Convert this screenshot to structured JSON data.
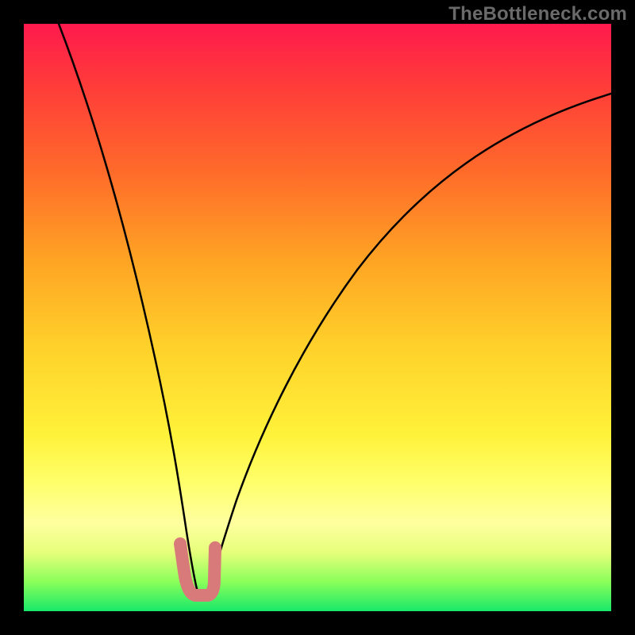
{
  "watermark": "TheBottleneck.com",
  "chart_data": {
    "type": "line",
    "title": "",
    "xlabel": "",
    "ylabel": "",
    "xlim": [
      0,
      100
    ],
    "ylim": [
      0,
      100
    ],
    "grid": false,
    "background_gradient": [
      "#ff1a4d",
      "#ff6a2a",
      "#ffd12a",
      "#ffff6a",
      "#18e86a"
    ],
    "series": [
      {
        "name": "bottleneck-curve",
        "color": "#000000",
        "x": [
          6,
          10,
          14,
          18,
          22,
          24,
          26,
          28,
          29,
          30,
          31,
          32,
          34,
          36,
          40,
          46,
          54,
          64,
          76,
          90,
          100
        ],
        "y": [
          100,
          85,
          68,
          50,
          30,
          18,
          8,
          2,
          0,
          0,
          0,
          2,
          10,
          20,
          36,
          52,
          65,
          75,
          82,
          86,
          88
        ]
      },
      {
        "name": "highlight-region",
        "color": "#d97a7a",
        "x": [
          26,
          26.5,
          27.5,
          29,
          30.5,
          31.5,
          32,
          32
        ],
        "y": [
          10,
          6,
          2,
          0,
          0,
          2,
          6,
          10
        ]
      }
    ],
    "annotations": []
  }
}
